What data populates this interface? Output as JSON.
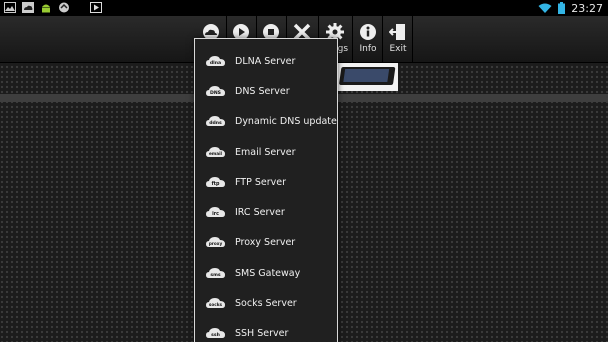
{
  "status_bar": {
    "time": "23:27",
    "left_icons": [
      "picture-icon",
      "cloud-icon",
      "android-icon",
      "sync-icon",
      "play-store-icon"
    ],
    "right_icons": [
      "wifi-icon",
      "battery-icon"
    ]
  },
  "toolbar": {
    "buttons": [
      {
        "name": "menu-toggle",
        "label": "",
        "icon": "cloud-menu-icon"
      },
      {
        "name": "start",
        "label": "",
        "icon": "play-icon"
      },
      {
        "name": "stop",
        "label": "",
        "icon": "stop-icon"
      },
      {
        "name": "remove",
        "label": "",
        "icon": "close-icon"
      },
      {
        "name": "settings",
        "label": "ngs",
        "icon": "gear-icon"
      },
      {
        "name": "info",
        "label": "Info",
        "icon": "info-icon"
      },
      {
        "name": "exit",
        "label": "Exit",
        "icon": "exit-icon"
      }
    ]
  },
  "menu": {
    "items": [
      {
        "label": "DLNA Server",
        "badge": "dlna"
      },
      {
        "label": "DNS Server",
        "badge": "DNS"
      },
      {
        "label": "Dynamic DNS updater",
        "badge": "ddns"
      },
      {
        "label": "Email Server",
        "badge": "email"
      },
      {
        "label": "FTP Server",
        "badge": "ftp"
      },
      {
        "label": "IRC Server",
        "badge": "irc"
      },
      {
        "label": "Proxy Server",
        "badge": "proxy"
      },
      {
        "label": "SMS Gateway",
        "badge": "sms"
      },
      {
        "label": "Socks Server",
        "badge": "socks"
      },
      {
        "label": "SSH Server",
        "badge": "ssh"
      }
    ]
  },
  "colors": {
    "background": "#1c1c1c",
    "menu_background": "#202020",
    "menu_border": "#d8d8d8",
    "accent_wifi": "#33b5e5"
  }
}
